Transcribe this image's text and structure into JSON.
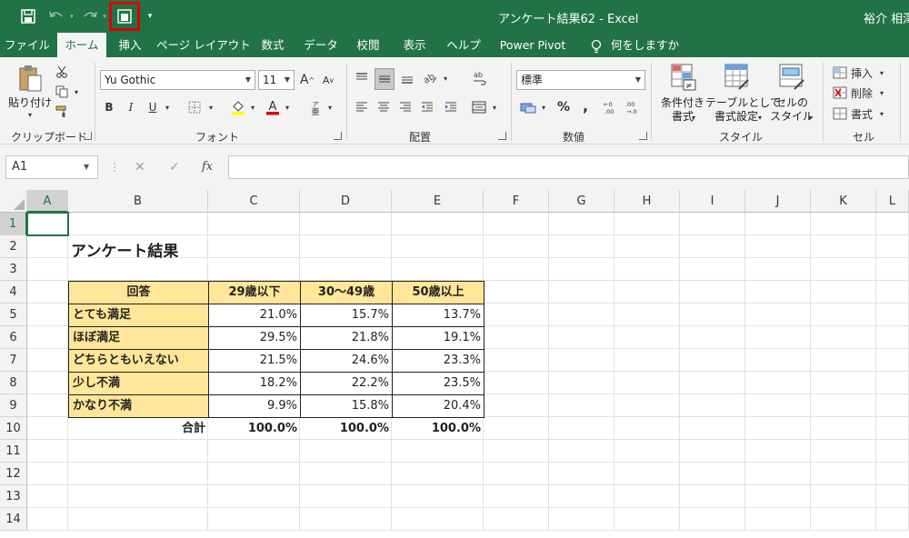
{
  "window": {
    "title": "アンケート結果62  -  Excel",
    "user": "裕介 相澤"
  },
  "qat": {
    "save_icon": "save-icon",
    "undo_icon": "undo-icon",
    "redo_icon": "redo-icon",
    "custom_icon": "window-icon",
    "more_icon": "dropdown-icon"
  },
  "tabs": [
    "ファイル",
    "ホーム",
    "挿入",
    "ページ レイアウト",
    "数式",
    "データ",
    "校閲",
    "表示",
    "ヘルプ",
    "Power Pivot",
    "何をしますか"
  ],
  "ribbon": {
    "clipboard": {
      "paste": "貼り付け",
      "label": "クリップボード"
    },
    "font": {
      "name": "Yu Gothic",
      "size": "11",
      "label": "フォント",
      "bold": "B",
      "italic": "I",
      "underline": "U",
      "grow": "A",
      "shrink": "A"
    },
    "alignment": {
      "label": "配置"
    },
    "number": {
      "format": "標準",
      "percent": "%",
      "comma": ",",
      "label": "数値"
    },
    "styles": {
      "cond_line1": "条件付き",
      "cond_line2": "書式",
      "table_line1": "テーブルとして",
      "table_line2": "書式設定",
      "cell_line1": "セルの",
      "cell_line2": "スタイル",
      "label": "スタイル"
    },
    "cells": {
      "insert": "挿入",
      "delete": "削除",
      "format": "書式",
      "label": "セル"
    }
  },
  "formula_bar": {
    "name_box": "A1",
    "cancel": "✕",
    "enter": "✓",
    "fx": "fx",
    "content": ""
  },
  "grid": {
    "columns": [
      "A",
      "B",
      "C",
      "D",
      "E",
      "F",
      "G",
      "H",
      "I",
      "J",
      "K",
      "L"
    ],
    "rows": [
      "1",
      "2",
      "3",
      "4",
      "5",
      "6",
      "7",
      "8",
      "9",
      "10",
      "11",
      "12",
      "13",
      "14"
    ]
  },
  "sheet": {
    "title": "アンケート結果",
    "headers": [
      "回答",
      "29歳以下",
      "30～49歳",
      "50歳以上"
    ],
    "rows": [
      {
        "label": "とても満足",
        "values": [
          "21.0%",
          "15.7%",
          "13.7%"
        ]
      },
      {
        "label": "ほぼ満足",
        "values": [
          "29.5%",
          "21.8%",
          "19.1%"
        ]
      },
      {
        "label": "どちらともいえない",
        "values": [
          "21.5%",
          "24.6%",
          "23.3%"
        ]
      },
      {
        "label": "少し不満",
        "values": [
          "18.2%",
          "22.2%",
          "23.5%"
        ]
      },
      {
        "label": "かなり不満",
        "values": [
          "9.9%",
          "15.8%",
          "20.4%"
        ]
      }
    ],
    "total": {
      "label": "合計",
      "values": [
        "100.0%",
        "100.0%",
        "100.0%"
      ]
    }
  },
  "colors": {
    "brand": "#217346",
    "header_fill": "#ffe699",
    "highlight": "#e00000"
  }
}
